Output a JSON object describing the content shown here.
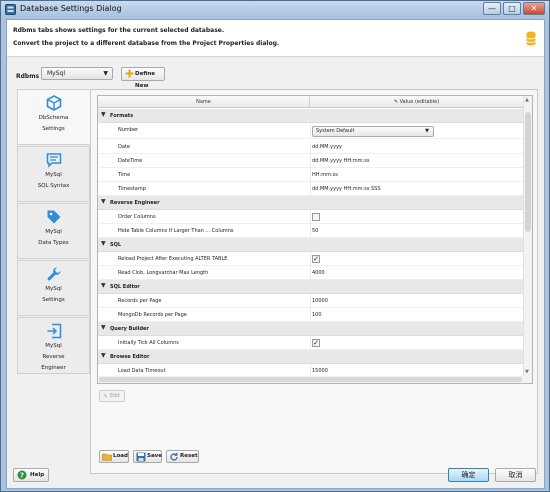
{
  "window": {
    "title": "Database Settings Dialog",
    "controls": {
      "minimize": "—",
      "maximize": "□",
      "close": "✕"
    }
  },
  "header": {
    "line1": "Rdbms tabs shows settings for the current selected database.",
    "line2": "Convert the project to a different database from the Project Properties dialog.",
    "icon": "database-icon"
  },
  "rdbms": {
    "label": "Rdbms",
    "selected": "MySql",
    "define_new_label": "Define New"
  },
  "sidebar": {
    "items": [
      {
        "icon": "cube-icon",
        "line1": "DbSchema",
        "line2": "Settings"
      },
      {
        "icon": "chat-icon",
        "line1": "MySql",
        "line2": "SQL Syntax"
      },
      {
        "icon": "tag-icon",
        "line1": "MySql",
        "line2": "Data Types"
      },
      {
        "icon": "wrench-icon",
        "line1": "MySql",
        "line2": "Settings"
      },
      {
        "icon": "login-icon",
        "line1": "MySql",
        "line2": "Reverse",
        "line3": "Engineer"
      }
    ]
  },
  "table": {
    "col_name": "Name",
    "col_value": "Value (editable)",
    "rows": [
      {
        "type": "cat",
        "label": "Formats"
      },
      {
        "type": "combo",
        "name": "Number",
        "value": "System Default"
      },
      {
        "type": "text",
        "name": "Date",
        "value": "dd.MM.yyyy"
      },
      {
        "type": "text",
        "name": "DateTime",
        "value": "dd.MM.yyyy HH:mm:ss"
      },
      {
        "type": "text",
        "name": "Time",
        "value": "HH:mm:ss"
      },
      {
        "type": "text",
        "name": "Timestamp",
        "value": "dd.MM.yyyy HH:mm:ss SSS"
      },
      {
        "type": "cat",
        "label": "Reverse Engineer"
      },
      {
        "type": "check",
        "name": "Order Columns",
        "value": ""
      },
      {
        "type": "text",
        "name": "Hide Table Columns If Larger Than ... Columns",
        "value": "50"
      },
      {
        "type": "cat",
        "label": "SQL"
      },
      {
        "type": "check",
        "name": "Reload Project After Executing ALTER TABLE",
        "value": "✓"
      },
      {
        "type": "text",
        "name": "Read Clob, Longvarchar Max Length",
        "value": "4000"
      },
      {
        "type": "cat",
        "label": "SQL Editor"
      },
      {
        "type": "text",
        "name": "Records per Page",
        "value": "10000"
      },
      {
        "type": "text",
        "name": "MongoDb Records per Page",
        "value": "100"
      },
      {
        "type": "cat",
        "label": "Query Builder"
      },
      {
        "type": "check",
        "name": "Initially Tick All Columns",
        "value": "✓"
      },
      {
        "type": "cat",
        "label": "Browse Editor"
      },
      {
        "type": "text",
        "name": "Load Data Timeout",
        "value": "15000"
      }
    ]
  },
  "buttons": {
    "edit": "Edit",
    "load": "Load",
    "save": "Save",
    "reset": "Reset",
    "help": "Help",
    "ok": "确定",
    "cancel": "取消"
  },
  "colors": {
    "accent": "#3a6ea5",
    "window_frame": "#a9c3df",
    "category_row": "#e8e8e8"
  }
}
